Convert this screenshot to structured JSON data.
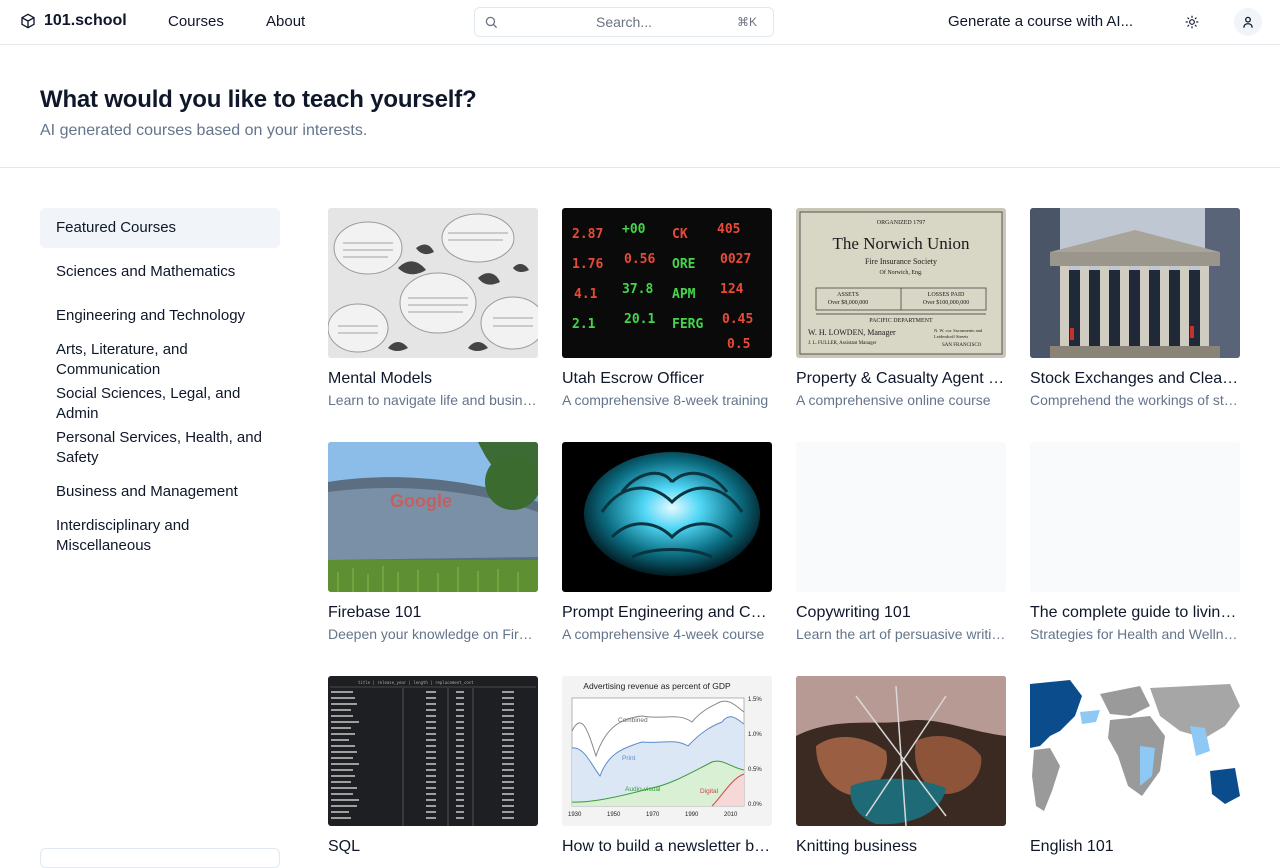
{
  "header": {
    "brand": "101.school",
    "nav": [
      "Courses",
      "About"
    ],
    "search_placeholder": "Search...",
    "search_shortcut": "⌘K",
    "generate_label": "Generate a course with AI..."
  },
  "hero": {
    "title": "What would you like to teach yourself?",
    "subtitle": "AI generated courses based on your interests."
  },
  "sidebar": {
    "items": [
      "Featured Courses",
      "Sciences and Mathematics",
      "Engineering and Technology",
      "Arts, Literature, and Communication",
      "Social Sciences, Legal, and Admin",
      "Personal Services, Health, and Safety",
      "Business and Management",
      "Interdisciplinary and Miscellaneous"
    ],
    "active": "Featured Courses"
  },
  "courses": [
    {
      "title": "Mental Models",
      "desc": "Learn to navigate life and business"
    },
    {
      "title": "Utah Escrow Officer",
      "desc": "A comprehensive 8-week training"
    },
    {
      "title": "Property & Casualty Agent License",
      "desc": "A comprehensive online course"
    },
    {
      "title": "Stock Exchanges and Clearing Houses",
      "desc": "Comprehend the workings of stock"
    },
    {
      "title": "Firebase 101",
      "desc": "Deepen your knowledge on Firebase"
    },
    {
      "title": "Prompt Engineering and ChatGPT",
      "desc": "A comprehensive 4-week course"
    },
    {
      "title": "Copywriting 101",
      "desc": "Learn the art of persuasive writing"
    },
    {
      "title": "The complete guide to living longer",
      "desc": "Strategies for Health and Wellness"
    },
    {
      "title": "SQL",
      "desc": ""
    },
    {
      "title": "How to build a newsletter business",
      "desc": ""
    },
    {
      "title": "Knitting business",
      "desc": ""
    },
    {
      "title": "English 101",
      "desc": ""
    }
  ],
  "thumb_texts": {
    "norwich": {
      "badge": "ORGANIZED 1797",
      "name": "The Norwich Union",
      "society": "Fire Insurance Society",
      "place": "Of Norwich, Eng.",
      "assets_label": "ASSETS",
      "assets_value": "Over $8,000,000",
      "losses_label": "LOSSES PAID",
      "losses_value": "Over $100,000,000",
      "dept": "PACIFIC DEPARTMENT",
      "manager": "W. H. LOWDEN, Manager",
      "asst": "J. L. FULLER, Assistant Manager",
      "addr1": "N. W. cor. Sacramento and",
      "addr2": "Leidesdorff Streets",
      "city": "SAN FRANCISCO"
    },
    "google": "Google",
    "sql_header": "title | release_year | length | replacement_cost",
    "ad_chart": {
      "title": "Advertising revenue as percent of GDP",
      "labels": [
        "Combined",
        "Print",
        "Audio-visual",
        "Digital"
      ],
      "x_ticks": [
        "1930",
        "1950",
        "1970",
        "1990",
        "2010"
      ],
      "y_ticks": [
        "1.5%",
        "1.0%",
        "0.5%",
        "0.0%"
      ]
    }
  },
  "colors": {
    "accent_bg": "#f1f5f9",
    "text_primary": "#0f172a",
    "text_muted": "#64748b",
    "border": "#e5e7eb"
  },
  "icons": {
    "brand": "cube-icon",
    "search": "search-icon",
    "theme": "sun-icon",
    "user": "user-icon"
  }
}
